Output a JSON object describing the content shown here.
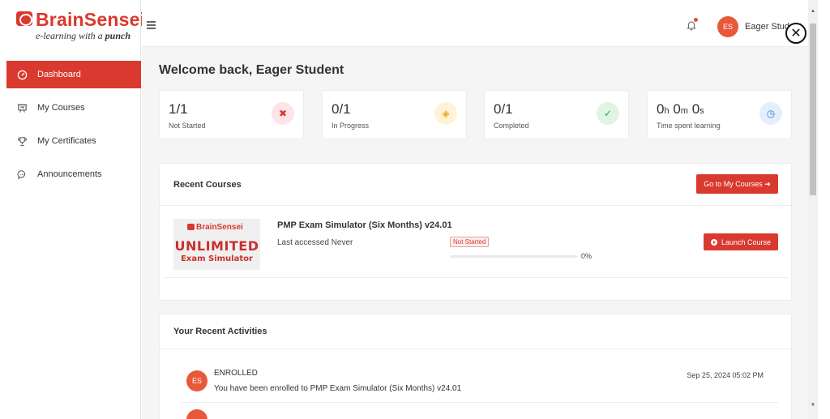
{
  "brand": {
    "name": "BrainSensei",
    "tagline_prefix": "e-learning with a ",
    "tagline_emphasis": "punch",
    "color": "#d9392e"
  },
  "sidebar": {
    "items": [
      {
        "label": "Dashboard",
        "icon": "gauge-icon",
        "active": true
      },
      {
        "label": "My Courses",
        "icon": "presentation-icon",
        "active": false
      },
      {
        "label": "My Certificates",
        "icon": "trophy-icon",
        "active": false
      },
      {
        "label": "Announcements",
        "icon": "chat-bubble-icon",
        "active": false
      }
    ]
  },
  "header": {
    "menu_icon": "hamburger-icon",
    "notification_icon": "bell-icon",
    "user_initials": "ES",
    "user_name": "Eager Student",
    "close_symbol": "✕"
  },
  "main": {
    "welcome": "Welcome back, Eager Student",
    "stats": [
      {
        "value": "1/1",
        "label": "Not Started",
        "icon": "x-icon",
        "icon_glyph": "✖",
        "icon_bg": "#fde4e6",
        "icon_color": "#d9392e"
      },
      {
        "value": "0/1",
        "label": "In Progress",
        "icon": "diamond-alert-icon",
        "icon_glyph": "◈",
        "icon_bg": "#fff3d6",
        "icon_color": "#e5a623"
      },
      {
        "value": "0/1",
        "label": "Completed",
        "icon": "check-circle-icon",
        "icon_glyph": "✓",
        "icon_bg": "#e0f4e6",
        "icon_color": "#35a05a"
      },
      {
        "value_h": "0",
        "unit_h": "h",
        "value_m": "0",
        "unit_m": "m",
        "value_s": "0",
        "unit_s": "s",
        "label": "Time spent learning",
        "icon": "clock-icon",
        "icon_glyph": "◷",
        "icon_bg": "#e3effa",
        "icon_color": "#3a7bc8"
      }
    ],
    "recent_courses": {
      "title": "Recent Courses",
      "goto_button": "Go to My Courses",
      "goto_arrow": "➔",
      "course": {
        "thumb_brand": "BrainSensei",
        "thumb_big": "UNLIMITED",
        "thumb_sub": "Exam Simulator",
        "name": "PMP Exam Simulator (Six Months) v24.01",
        "last_accessed": "Last accessed Never",
        "status": "Not Started",
        "progress": 0,
        "progress_label": "0%",
        "launch_button": "Launch Course"
      }
    },
    "recent_activities": {
      "title": "Your Recent Activities",
      "items": [
        {
          "initials": "ES",
          "type": "ENROLLED",
          "description": "You have been enrolled to PMP Exam Simulator (Six Months) v24.01",
          "date": "Sep 25, 2024 05:02 PM"
        }
      ]
    }
  }
}
